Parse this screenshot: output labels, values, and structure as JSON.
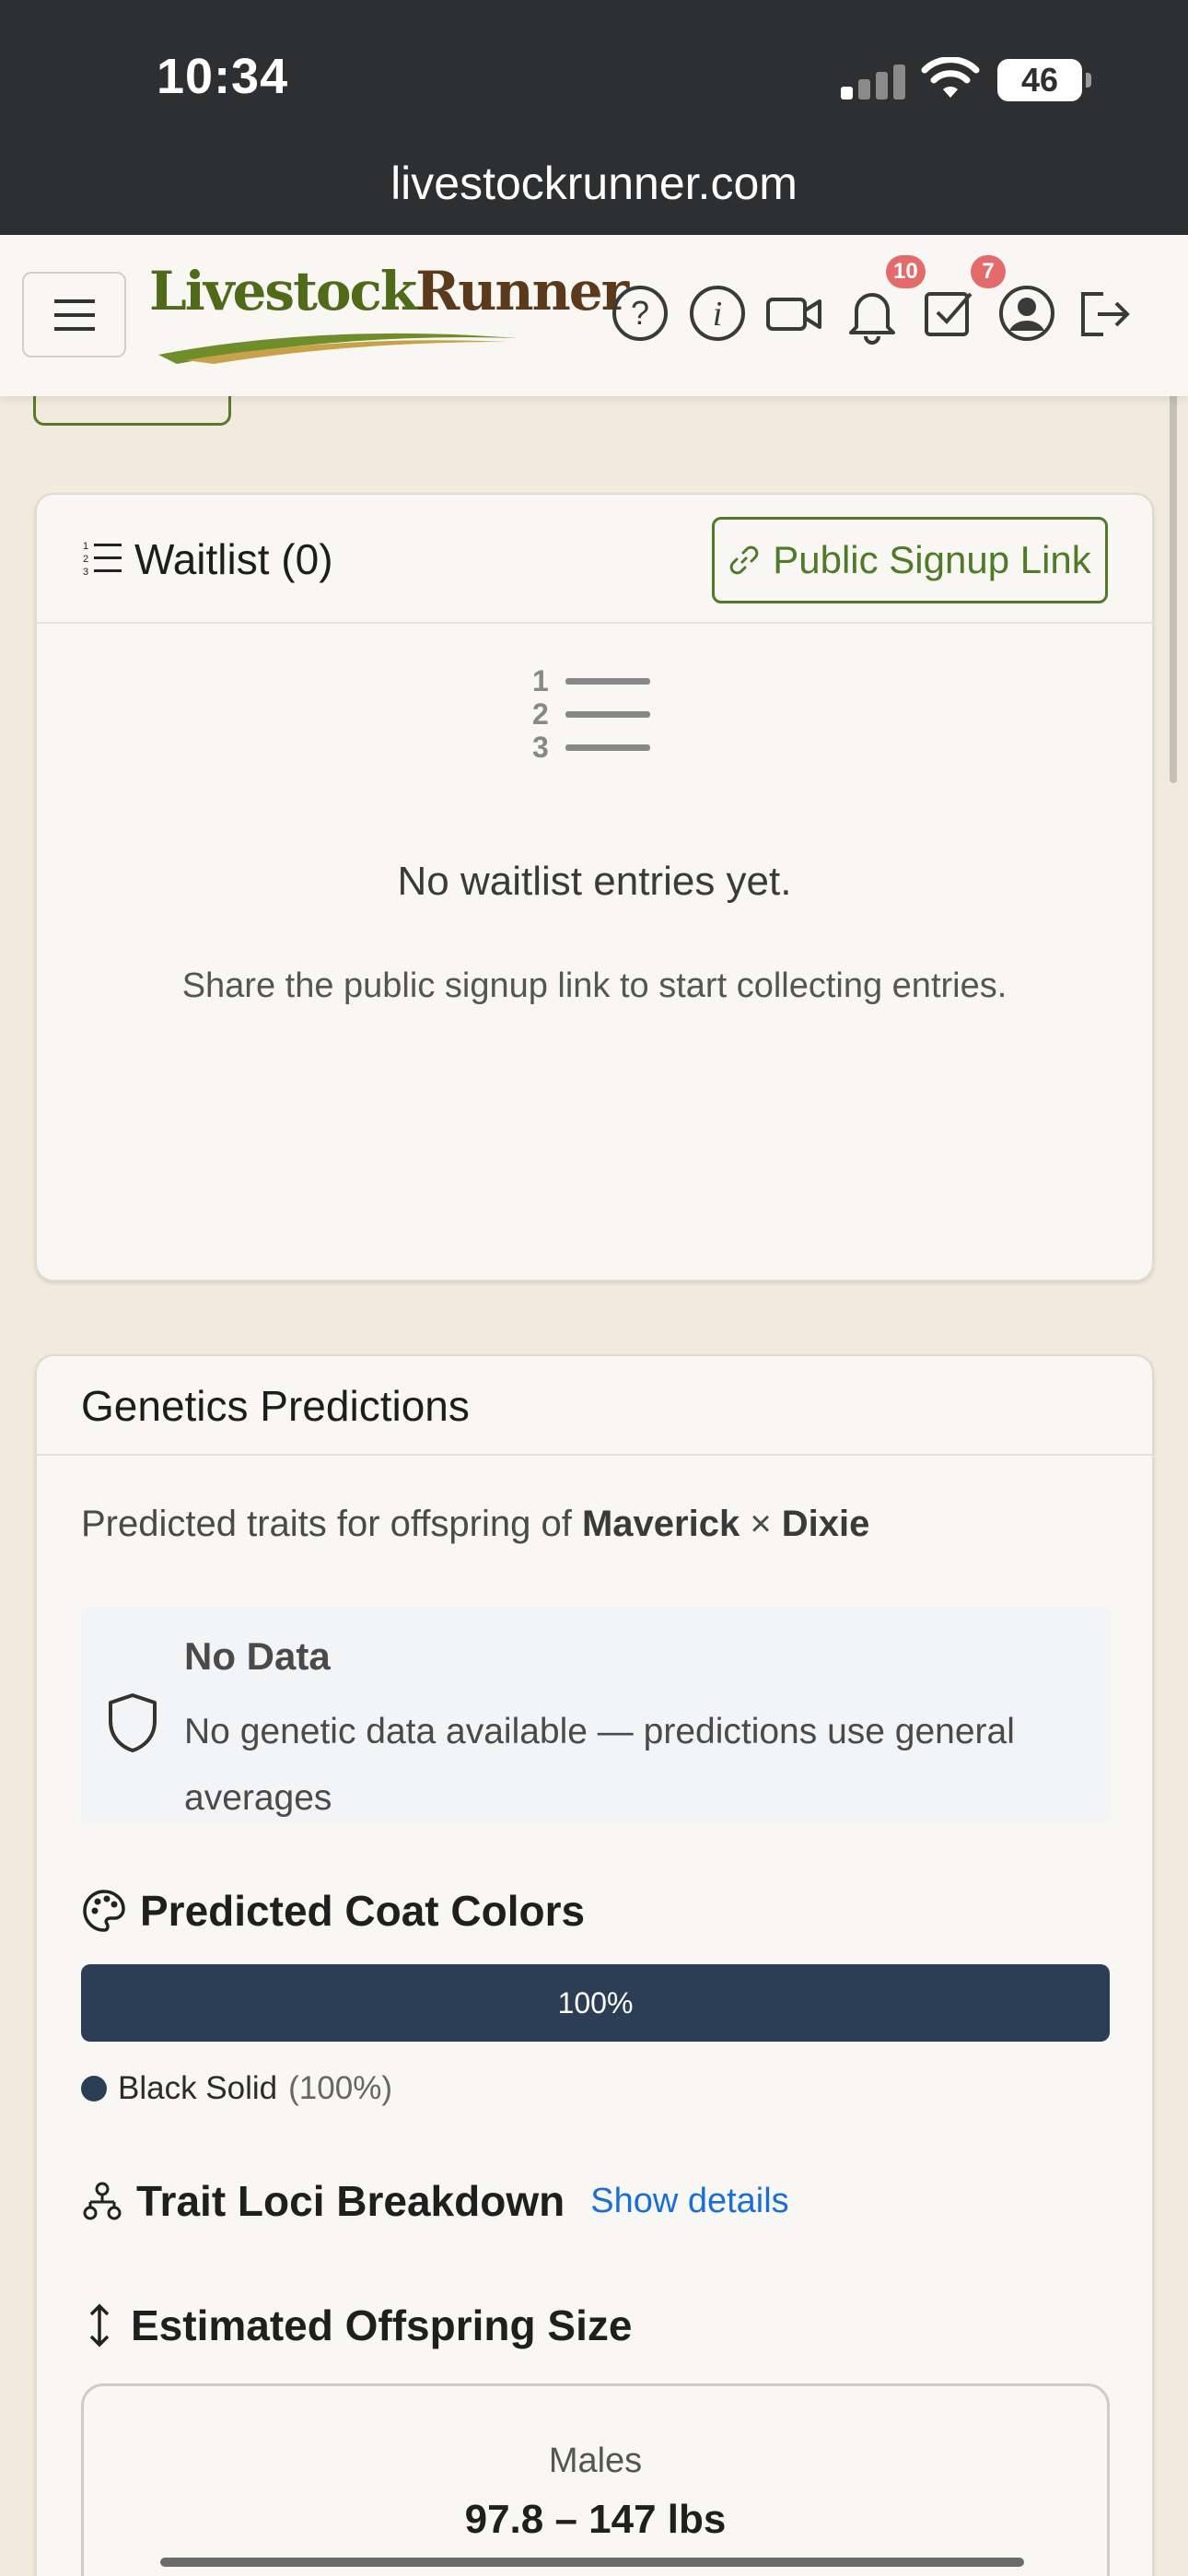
{
  "status_bar": {
    "time": "10:34",
    "battery": "46",
    "url": "livestockrunner.com"
  },
  "header": {
    "logo_text_1": "Livestock",
    "logo_text_2": "Runner",
    "notifications_badge": "10",
    "tasks_badge": "7",
    "icons": [
      "menu-icon",
      "help-icon",
      "info-icon",
      "video-icon",
      "bell-icon",
      "tasks-check-icon",
      "user-account-icon",
      "logout-icon"
    ]
  },
  "waitlist": {
    "title": "Waitlist (0)",
    "signup_button": "Public Signup Link",
    "empty_title": "No waitlist entries yet.",
    "empty_subtitle": "Share the public signup link to start collecting entries.",
    "empty_icon_numbers": [
      "1",
      "2",
      "3"
    ]
  },
  "genetics": {
    "title": "Genetics Predictions",
    "predicted_prefix": "Predicted traits for offspring of ",
    "sire": "Maverick",
    "cross": " × ",
    "dam": "Dixie",
    "no_data_title": "No Data",
    "no_data_text": "No genetic data available — predictions use general averages",
    "coat_colors_title": "Predicted Coat Colors",
    "coat_bar": {
      "label": "100%",
      "fraction": 1.0,
      "color": "#2c3e55"
    },
    "legend": {
      "name": "Black Solid",
      "pct": "(100%)"
    },
    "trait_loci_title": "Trait Loci Breakdown",
    "show_details": "Show details",
    "offspring_size_title": "Estimated Offspring Size",
    "size": {
      "label": "Males",
      "value": "97.8 – 147 lbs"
    }
  },
  "colors": {
    "accent_green": "#4f7a28",
    "badge_red": "#e46b6b",
    "link_blue": "#1a6fd6",
    "bar_navy": "#2c3e55"
  }
}
